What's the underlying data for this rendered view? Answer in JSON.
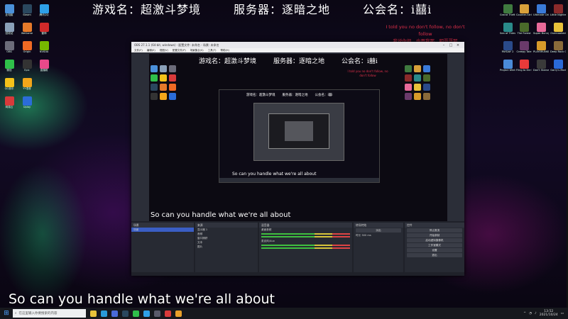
{
  "overlay": {
    "game_name": "游戏名：超激斗梦境",
    "server": "服务器：逐暗之地",
    "guild": "公会名：i囍i",
    "quote_line1": "I told you no don't follow, no don't follow",
    "quote_line2": "我说你很，也再我那，明哥哥那"
  },
  "desktop_icons_left": [
    {
      "label": "此电脑",
      "color": "#4a90d9"
    },
    {
      "label": "回收站",
      "color": "#8aa0b8"
    },
    {
      "label": "OBS",
      "color": "#6c6c7a"
    },
    {
      "label": "微信",
      "color": "#2fbf4a"
    },
    {
      "label": "QQ音乐",
      "color": "#f2c21a"
    },
    {
      "label": "网易云",
      "color": "#d83a3a"
    },
    {
      "label": "Steam",
      "color": "#2a475e"
    },
    {
      "label": "WeGame",
      "color": "#e67a2a"
    },
    {
      "label": "Origin",
      "color": "#f06a24"
    },
    {
      "label": "Epic",
      "color": "#333"
    },
    {
      "label": "YY语音",
      "color": "#f2a61a"
    },
    {
      "label": "Uplay",
      "color": "#2b6cd8"
    },
    {
      "label": "腾讯QQ",
      "color": "#2ea0e8"
    },
    {
      "label": "雷神",
      "color": "#d02a2a"
    },
    {
      "label": "NVIDIA",
      "color": "#76b900"
    },
    {
      "label": "直播姬",
      "color": "#e8498a"
    }
  ],
  "desktop_icons_right": [
    {
      "label": "Grand Theft Auto V",
      "color": "#3f7a3f"
    },
    {
      "label": "Counter-Strike",
      "color": "#d8a03a"
    },
    {
      "label": "Ultimate Chicken",
      "color": "#3a7ad8"
    },
    {
      "label": "Little Nightmares",
      "color": "#8a2a2a"
    },
    {
      "label": "Sea of Thieves",
      "color": "#2a8a8a"
    },
    {
      "label": "The Forest",
      "color": "#4a6a2a"
    },
    {
      "label": "Super Bunny Man",
      "color": "#e86a9a"
    },
    {
      "label": "Overcooked",
      "color": "#e8c23a"
    },
    {
      "label": "PAYDAY 2",
      "color": "#2a4a8a"
    },
    {
      "label": "Creepy Tale",
      "color": "#6a3a6a"
    },
    {
      "label": "PLAYERUNKNOWN'S BATTLEGROUNDS",
      "color": "#d89a2a"
    },
    {
      "label": "Deep Rock Galactic",
      "color": "#8a6a3a"
    },
    {
      "label": "Project Winter",
      "color": "#4a8ad8"
    },
    {
      "label": "Fling to the Finish",
      "color": "#e83a3a"
    },
    {
      "label": "Don't Starve",
      "color": "#3a3a3a"
    },
    {
      "label": "Garry's Mod",
      "color": "#2a6ad8"
    }
  ],
  "obs": {
    "window_title": "OBS 27.1.1 (64-bit, windows) - 配置文件: 未命名 - 场景: 未命名",
    "menu": [
      "文件(F)",
      "编辑(E)",
      "视图(V)",
      "配置文件(P)",
      "场景集合(S)",
      "工具(T)",
      "帮助(H)"
    ],
    "docks": {
      "scenes_title": "场景",
      "scenes": [
        "场景"
      ],
      "sources_title": "来源",
      "sources": [
        "显示器 1",
        "音频",
        "窗口捕获",
        "文本",
        "图片"
      ],
      "mixer_title": "混音器",
      "mixer": [
        "桌面音频",
        "麦克风/Aux"
      ],
      "transitions_title": "转场特效",
      "transition": "淡出",
      "duration_label": "时长",
      "duration": "300 ms",
      "controls_title": "控件",
      "controls": [
        "停止推流",
        "开始录制",
        "启动虚拟摄像机",
        "工作室模式",
        "设置",
        "退出"
      ]
    },
    "nested_caption": "So can you handle what we're all about",
    "preview_caption": "So can you handle what we're all about"
  },
  "caption": "So can you handle what we're all about",
  "taskbar": {
    "search_placeholder": "在这里输入你要搜索的内容",
    "apps": [
      {
        "name": "file-explorer-icon",
        "color": "#e8c23a"
      },
      {
        "name": "edge-icon",
        "color": "#2a9ad8"
      },
      {
        "name": "store-icon",
        "color": "#4a6ad8"
      },
      {
        "name": "steam-icon",
        "color": "#2a475e"
      },
      {
        "name": "wechat-icon",
        "color": "#2fbf4a"
      },
      {
        "name": "qq-icon",
        "color": "#2ea0e8"
      },
      {
        "name": "obs-icon",
        "color": "#5a5a6a"
      },
      {
        "name": "game-icon",
        "color": "#d83a3a"
      },
      {
        "name": "chrome-icon",
        "color": "#e8a02a"
      }
    ],
    "time": "13:52",
    "date": "2021/10/24"
  }
}
